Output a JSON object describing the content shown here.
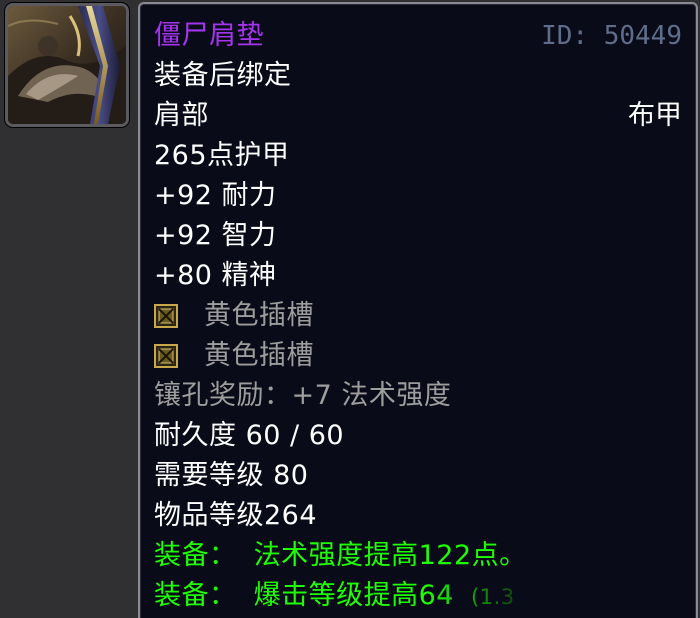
{
  "item": {
    "icon": "shoulder-pad-icon",
    "name": "僵尸肩垫",
    "id_text": "ID: 50449",
    "bind": "装备后绑定",
    "slot": "肩部",
    "armor_type": "布甲",
    "armor": "265点护甲",
    "stats": [
      "+92 耐力",
      "+92 智力",
      "+80 精神"
    ],
    "sockets": [
      {
        "label": "黄色插槽",
        "icon": "yellow-socket-icon"
      },
      {
        "label": "黄色插槽",
        "icon": "yellow-socket-icon"
      }
    ],
    "socket_bonus": "镶孔奖励：+7 法术强度",
    "durability": "耐久度 60 / 60",
    "required_level": "需要等级 80",
    "item_level": "物品等级264",
    "equip_effects": [
      {
        "prefix": "装备：",
        "text": "法术强度提高122点。",
        "note": ""
      },
      {
        "prefix": "装备：",
        "text": "爆击等级提高64",
        "note": "(1.3"
      }
    ]
  },
  "colors": {
    "name": "#a335ee",
    "id": "#5f6d8a",
    "white": "#ffffff",
    "grey": "#9d9d9d",
    "green": "#1eff00",
    "tooltip_bg": "#0a0b18",
    "border": "#8a8a92"
  }
}
